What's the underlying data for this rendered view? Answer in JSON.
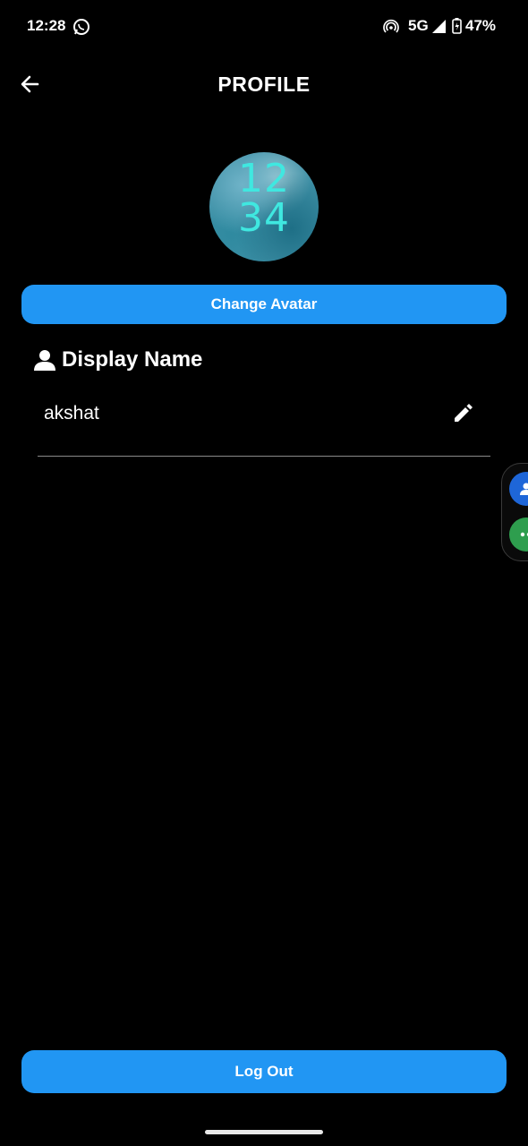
{
  "status_bar": {
    "time": "12:28",
    "network": "5G",
    "battery": "47%",
    "icons": [
      "whatsapp-icon",
      "hotspot-icon",
      "signal-icon",
      "battery-icon"
    ]
  },
  "header": {
    "title": "PROFILE",
    "back_icon": "arrow-left-icon"
  },
  "avatar": {
    "text_line1": "12",
    "text_line2": "34"
  },
  "buttons": {
    "change_avatar": "Change Avatar",
    "logout": "Log Out"
  },
  "display_name": {
    "label": "Display Name",
    "icon": "person-icon",
    "value": "akshat",
    "edit_icon": "pencil-icon"
  },
  "side_panel": {
    "icons": [
      "contacts-icon",
      "more-icon"
    ]
  },
  "colors": {
    "background": "#000000",
    "accent": "#2196f3",
    "text": "#ffffff",
    "divider": "#8a8a8a"
  }
}
